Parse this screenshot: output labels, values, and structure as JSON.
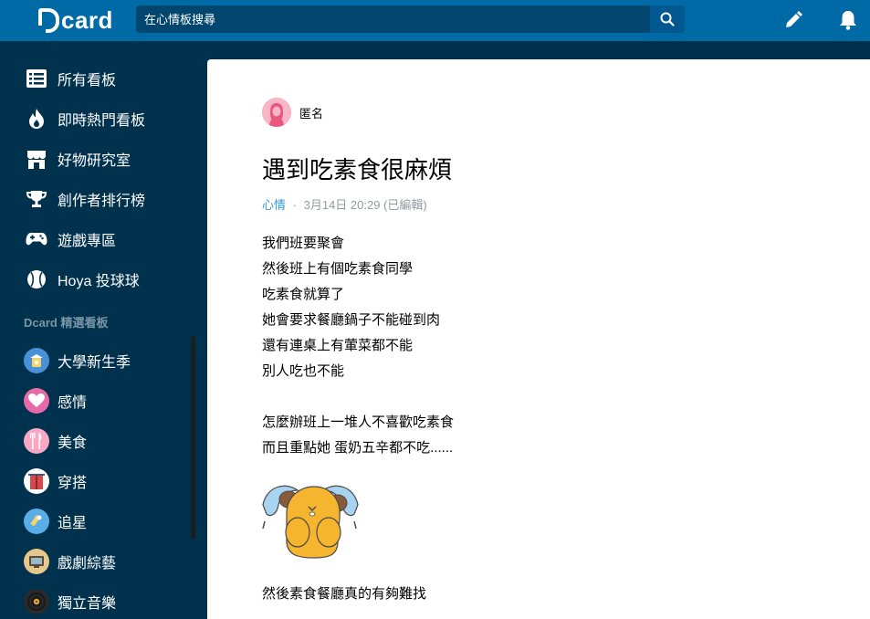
{
  "header": {
    "logo_text": "card",
    "search_placeholder": "在心情板搜尋"
  },
  "sidebar": {
    "nav": [
      {
        "label": "所有看板",
        "icon": "list-icon"
      },
      {
        "label": "即時熱門看板",
        "icon": "fire-icon"
      },
      {
        "label": "好物研究室",
        "icon": "store-icon"
      },
      {
        "label": "創作者排行榜",
        "icon": "trophy-icon"
      },
      {
        "label": "遊戲專區",
        "icon": "gamepad-icon"
      },
      {
        "label": "Hoya 投球球",
        "icon": "baseball-icon"
      }
    ],
    "section_title": "Dcard 精選看板",
    "boards": [
      {
        "label": "大學新生季",
        "icon": "freshman-icon",
        "color": "#4a90d9"
      },
      {
        "label": "感情",
        "icon": "heart-icon",
        "color": "#e86aa8"
      },
      {
        "label": "美食",
        "icon": "cutlery-icon",
        "color": "#f7a8c4"
      },
      {
        "label": "穿搭",
        "icon": "clothes-icon",
        "color": "#d94848"
      },
      {
        "label": "追星",
        "icon": "star-fan-icon",
        "color": "#5aaee8"
      },
      {
        "label": "戲劇綜藝",
        "icon": "tv-icon",
        "color": "#e8b85a"
      },
      {
        "label": "獨立音樂",
        "icon": "vinyl-icon",
        "color": "#2a2a2a"
      }
    ]
  },
  "post": {
    "author": "匿名",
    "title": "遇到吃素食很麻煩",
    "forum": "心情",
    "separator": "·",
    "timestamp": "3月14日 20:29 (已編輯)",
    "lines": [
      "我們班要聚會",
      "然後班上有個吃素食同學",
      "吃素食就算了",
      "她會要求餐廳鍋子不能碰到肉",
      "還有連桌上有葷菜都不能",
      "別人吃也不能",
      "怎麼辦班上一堆人不喜歡吃素食",
      "而且重點她 蛋奶五辛都不吃......",
      "然後素食餐廳真的有夠難找"
    ]
  },
  "colors": {
    "topbar": "#006aa6",
    "sidebar": "#00324e",
    "accent": "#3397cf"
  }
}
